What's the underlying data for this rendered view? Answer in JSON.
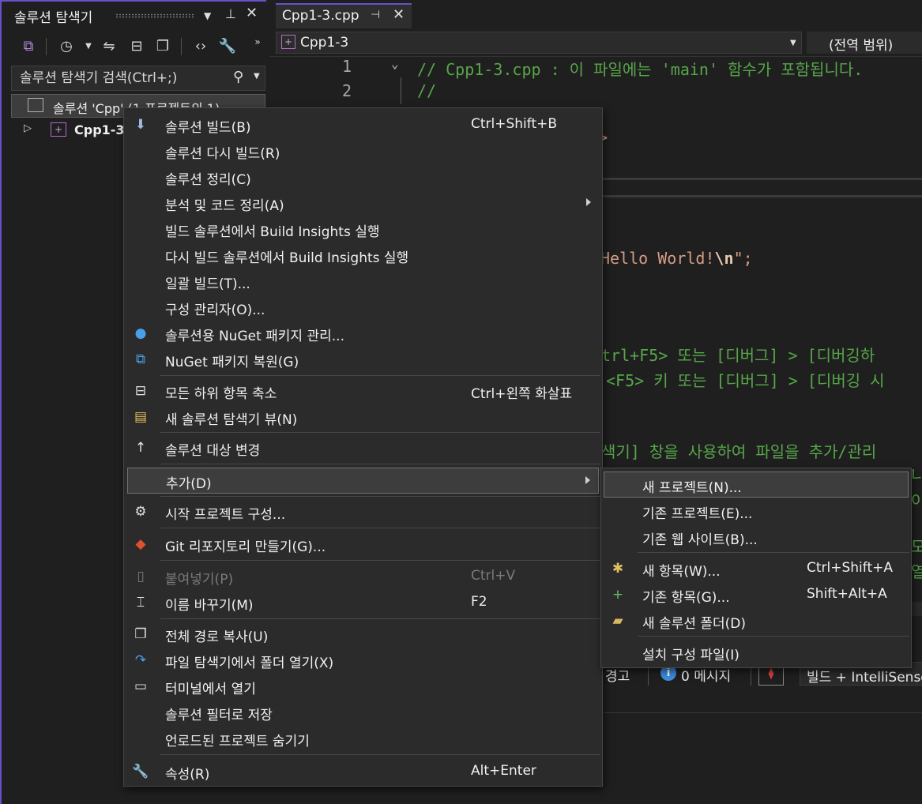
{
  "solution_explorer": {
    "title": "솔루션 탐색기",
    "search_placeholder": "솔루션 탐색기 검색(Ctrl+;)",
    "tree": {
      "solution_label": "솔루션 'Cpp' (1 프로젝트의 1)",
      "project_label": "Cpp1-3"
    }
  },
  "editor": {
    "tab_name": "Cpp1-3.cpp",
    "nav_file": "Cpp1-3",
    "nav_scope": "(전역 범위)",
    "line_numbers": [
      "1",
      "2"
    ],
    "lines": {
      "l1": "// Cpp1-3.cpp : 이 파일에는 'main' 함수가 포함됩니다.",
      "l2": "//",
      "frag_gt": ">",
      "hello_str": "Hello World!",
      "hello_esc": "\\n",
      "hello_end": "\";",
      "c1": "trl+F5> 또는 [디버그] > [디버깅하",
      "c2": "<F5> 키 또는 [디버그] > [디버깅 시",
      "c3": "색기] 창을 사용하여 파일을 추가/관리",
      "c4": "니",
      "c5": "이",
      "c6": "모",
      "c7": "열"
    }
  },
  "output": {
    "warnings_label": "경고",
    "messages_label": "0 메시지",
    "build_filter": "빌드 + IntelliSense"
  },
  "context_menu": {
    "items": [
      {
        "label": "솔루션 빌드(B)",
        "shortcut": "Ctrl+Shift+B"
      },
      {
        "label": "솔루션 다시 빌드(R)",
        "shortcut": ""
      },
      {
        "label": "솔루션 정리(C)",
        "shortcut": ""
      },
      {
        "label": "분석 및 코드 정리(A)",
        "shortcut": ""
      },
      {
        "label": "빌드 솔루션에서 Build Insights 실행",
        "shortcut": ""
      },
      {
        "label": "다시 빌드 솔루션에서 Build Insights 실행",
        "shortcut": ""
      },
      {
        "label": "일괄 빌드(T)...",
        "shortcut": ""
      },
      {
        "label": "구성 관리자(O)...",
        "shortcut": ""
      },
      {
        "label": "솔루션용 NuGet 패키지 관리...",
        "shortcut": ""
      },
      {
        "label": "NuGet 패키지 복원(G)",
        "shortcut": ""
      },
      {
        "label": "모든 하위 항목 축소",
        "shortcut": "Ctrl+왼쪽 화살표"
      },
      {
        "label": "새 솔루션 탐색기 뷰(N)",
        "shortcut": ""
      },
      {
        "label": "솔루션 대상 변경",
        "shortcut": ""
      },
      {
        "label": "추가(D)",
        "shortcut": ""
      },
      {
        "label": "시작 프로젝트 구성...",
        "shortcut": ""
      },
      {
        "label": "Git 리포지토리 만들기(G)...",
        "shortcut": ""
      },
      {
        "label": "붙여넣기(P)",
        "shortcut": "Ctrl+V"
      },
      {
        "label": "이름 바꾸기(M)",
        "shortcut": "F2"
      },
      {
        "label": "전체 경로 복사(U)",
        "shortcut": ""
      },
      {
        "label": "파일 탐색기에서 폴더 열기(X)",
        "shortcut": ""
      },
      {
        "label": "터미널에서 열기",
        "shortcut": ""
      },
      {
        "label": "솔루션 필터로 저장",
        "shortcut": ""
      },
      {
        "label": "언로드된 프로젝트 숨기기",
        "shortcut": ""
      },
      {
        "label": "속성(R)",
        "shortcut": "Alt+Enter"
      }
    ]
  },
  "submenu_add": {
    "items": [
      {
        "label": "새 프로젝트(N)...",
        "shortcut": ""
      },
      {
        "label": "기존 프로젝트(E)...",
        "shortcut": ""
      },
      {
        "label": "기존 웹 사이트(B)...",
        "shortcut": ""
      },
      {
        "label": "새 항목(W)...",
        "shortcut": "Ctrl+Shift+A"
      },
      {
        "label": "기존 항목(G)...",
        "shortcut": "Shift+Alt+A"
      },
      {
        "label": "새 솔루션 폴더(D)",
        "shortcut": ""
      },
      {
        "label": "설치 구성 파일(I)",
        "shortcut": ""
      }
    ]
  },
  "colors": {
    "accent": "#6a4fc7",
    "comment": "#57a64a",
    "string": "#d69d85",
    "menu_bg": "#2b2b2b"
  }
}
